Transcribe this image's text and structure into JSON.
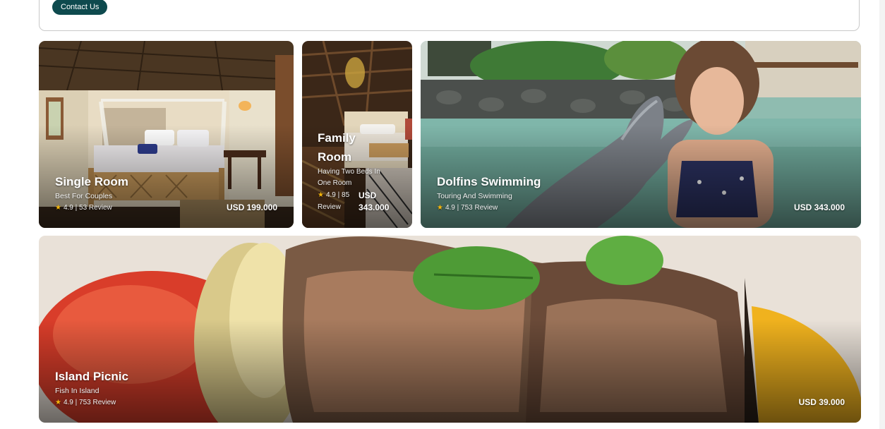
{
  "header": {
    "contact_label": "Contact Us"
  },
  "cards": [
    {
      "title": "Single Room",
      "subtitle": "Best For Couples",
      "rating": "4.9",
      "reviews": "53 Review",
      "price": "USD 199.000"
    },
    {
      "title_line1": "Family",
      "title_line2": "Room",
      "subtitle_line1": "Having Two Beds In",
      "subtitle_line2": "One Room",
      "rating": "4.9 | 85",
      "reviews": "Review",
      "price_currency": "USD",
      "price_amount": "343.000"
    },
    {
      "title": "Dolfins Swimming",
      "subtitle": "Touring And Swimming",
      "rating": "4.9",
      "reviews": "753 Review",
      "price": "USD 343.000"
    },
    {
      "title": "Island Picnic",
      "subtitle": "Fish In Island",
      "rating": "4.9",
      "reviews": "753 Review",
      "price": "USD 39.000"
    }
  ],
  "icons": {
    "rating": "star-icon"
  },
  "colors": {
    "accent": "#0e4a4e",
    "star": "#f5b50a"
  }
}
